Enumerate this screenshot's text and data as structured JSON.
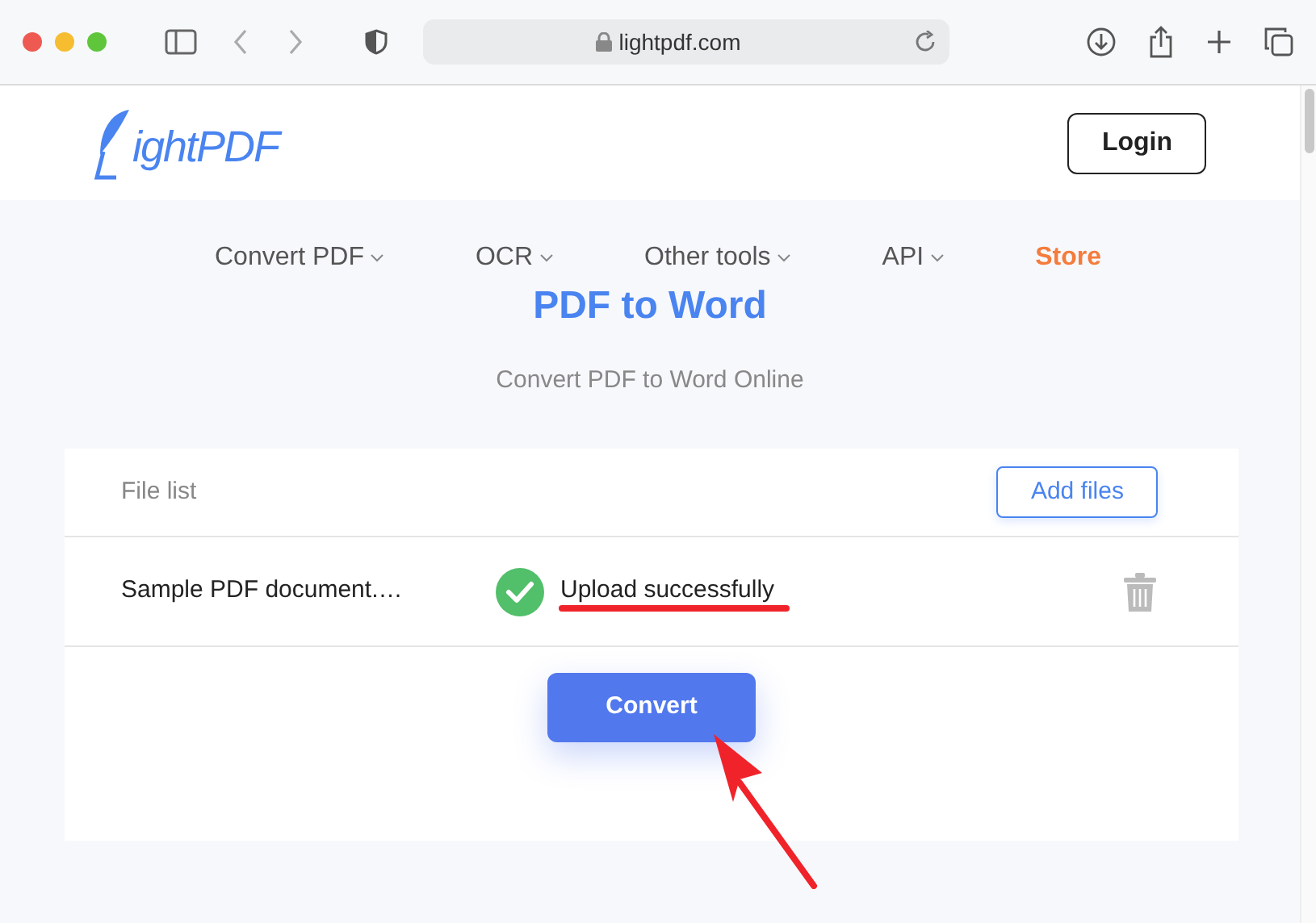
{
  "browser": {
    "url": "lightpdf.com"
  },
  "header": {
    "logo": "ightPDF",
    "login": "Login"
  },
  "nav": [
    {
      "label": "Convert PDF",
      "dropdown": true,
      "highlight": false
    },
    {
      "label": "OCR",
      "dropdown": true,
      "highlight": false
    },
    {
      "label": "Other tools",
      "dropdown": true,
      "highlight": false
    },
    {
      "label": "API",
      "dropdown": true,
      "highlight": false
    },
    {
      "label": "Store",
      "dropdown": false,
      "highlight": true
    }
  ],
  "title": "PDF to Word",
  "subtitle": "Convert PDF to Word Online",
  "file_list": {
    "heading": "File list",
    "add_button": "Add files",
    "files": [
      {
        "name": "Sample PDF document.…",
        "status": "Upload successfully"
      }
    ]
  },
  "convert_button": "Convert",
  "annotations": {
    "underline": true,
    "arrow": true
  }
}
